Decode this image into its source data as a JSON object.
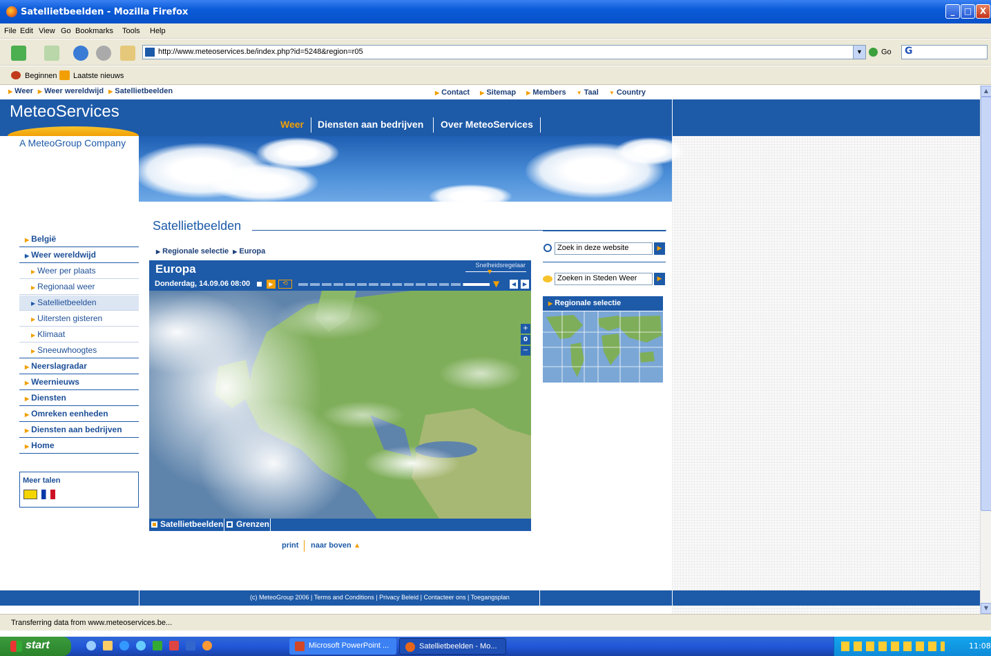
{
  "window": {
    "title": "Satellietbeelden - Mozilla Firefox"
  },
  "menu": [
    "File",
    "Edit",
    "View",
    "Go",
    "Bookmarks",
    "Tools",
    "Help"
  ],
  "toolbar": {
    "url": "http://www.meteoservices.be/index.php?id=5248&region=r05",
    "go_label": "Go",
    "search_text": "G"
  },
  "bookmarks": [
    "Beginnen",
    "Laatste nieuws"
  ],
  "breadcrumb": [
    "Weer",
    "Weer wereldwijd",
    "Satellietbeelden"
  ],
  "utility_links": [
    "Contact",
    "Sitemap",
    "Members",
    "Taal",
    "Country"
  ],
  "brand": {
    "logo": "MeteoServices",
    "tagline": "A MeteoGroup Company"
  },
  "top_nav": [
    "Weer",
    "Diensten aan bedrijven",
    "Over MeteoServices"
  ],
  "left_nav": [
    {
      "label": "België",
      "level": 0
    },
    {
      "label": "Weer wereldwijd",
      "level": 0
    },
    {
      "label": "Weer per plaats",
      "level": 1
    },
    {
      "label": "Regionaal weer",
      "level": 1
    },
    {
      "label": "Satellietbeelden",
      "level": 1,
      "active": true
    },
    {
      "label": "Uitersten gisteren",
      "level": 1
    },
    {
      "label": "Klimaat",
      "level": 1
    },
    {
      "label": "Sneeuwhoogtes",
      "level": 1
    },
    {
      "label": "Neerslagradar",
      "level": 0
    },
    {
      "label": "Weernieuws",
      "level": 0
    },
    {
      "label": "Diensten",
      "level": 0
    },
    {
      "label": "Omreken eenheden",
      "level": 0
    },
    {
      "label": "Diensten aan bedrijven",
      "level": 0
    },
    {
      "label": "Home",
      "level": 0
    }
  ],
  "meer_talen": "Meer talen",
  "main": {
    "heading": "Satellietbeelden",
    "sub_crumb": [
      "Regionale selectie",
      "Europa"
    ],
    "map_title": "Europa",
    "speed_label": "Snelheidsregelaar",
    "timestamp": "Donderdag, 14.09.06 08:00",
    "zoom_level": "0",
    "layers": [
      "Satellietbeelden",
      "Grenzen"
    ],
    "print": "print",
    "top_link": "naar boven"
  },
  "sidebar": {
    "search_site": "Zoek in deze website",
    "search_cities": "Zoeken in Steden Weer",
    "regional": "Regionale selectie"
  },
  "footer": "(c) MeteoGroup 2006 | Terms and Conditions | Privacy Beleid | Contacteer ons | Toegangsplan",
  "status": "Transferring data from www.meteoservices.be...",
  "taskbar": {
    "start": "start",
    "tasks": [
      "Microsoft PowerPoint ...",
      "Satellietbeelden - Mo..."
    ],
    "clock": "11:08"
  },
  "colors": {
    "brand_blue": "#1d5aa8",
    "accent_orange": "#f29f05",
    "map_land": "#7fae5a"
  }
}
